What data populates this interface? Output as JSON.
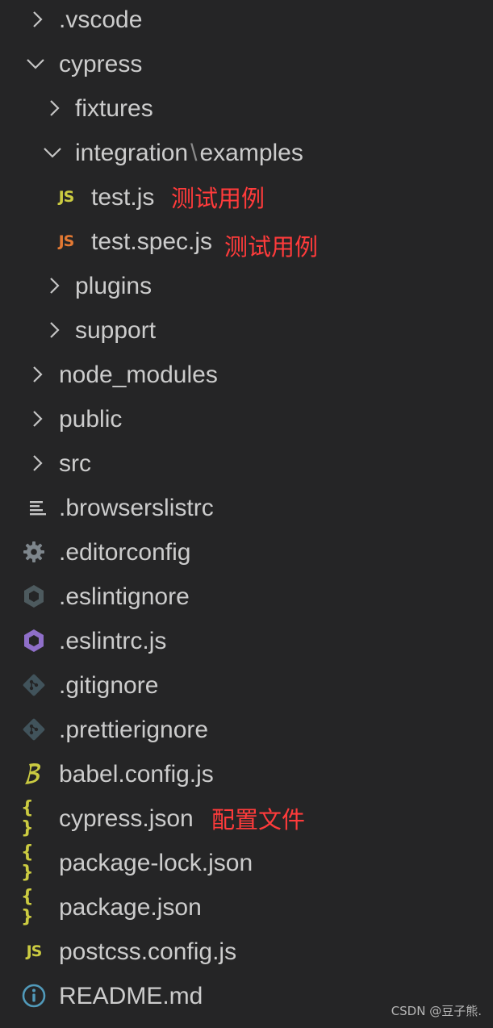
{
  "explorer": {
    "rows": [
      {
        "label": ".vscode",
        "icon": "chevron-right-icon"
      },
      {
        "label": "cypress",
        "icon": "chevron-down-icon"
      },
      {
        "label": "fixtures",
        "icon": "chevron-right-icon"
      },
      {
        "label_part1": "integration",
        "label_sep": "\\",
        "label_part2": "examples",
        "icon": "chevron-down-icon"
      },
      {
        "label": "test.js",
        "icon": "js-icon",
        "note": "测试用例"
      },
      {
        "label": "test.spec.js",
        "icon": "js-test-icon",
        "note": "测试用例"
      },
      {
        "label": "plugins",
        "icon": "chevron-right-icon"
      },
      {
        "label": "support",
        "icon": "chevron-right-icon"
      },
      {
        "label": "node_modules",
        "icon": "chevron-right-icon"
      },
      {
        "label": "public",
        "icon": "chevron-right-icon"
      },
      {
        "label": "src",
        "icon": "chevron-right-icon"
      },
      {
        "label": ".browserslistrc",
        "icon": "list-icon"
      },
      {
        "label": ".editorconfig",
        "icon": "gear-icon"
      },
      {
        "label": ".eslintignore",
        "icon": "eslint-icon"
      },
      {
        "label": ".eslintrc.js",
        "icon": "eslint-icon"
      },
      {
        "label": ".gitignore",
        "icon": "git-icon"
      },
      {
        "label": ".prettierignore",
        "icon": "git-icon"
      },
      {
        "label": "babel.config.js",
        "icon": "babel-icon"
      },
      {
        "label": "cypress.json",
        "icon": "json-icon",
        "note": "配置文件"
      },
      {
        "label": "package-lock.json",
        "icon": "json-icon"
      },
      {
        "label": "package.json",
        "icon": "json-icon"
      },
      {
        "label": "postcss.config.js",
        "icon": "js-icon"
      },
      {
        "label": "README.md",
        "icon": "info-icon"
      }
    ],
    "icon_glyphs": {
      "js": "JS",
      "json": "{ }"
    }
  },
  "colors": {
    "background": "#252526",
    "text": "#cccccc",
    "annotation": "#ff3b3b",
    "js_yellow": "#cbcb41",
    "js_test_orange": "#e37933",
    "eslint_gray": "#4d5a5e",
    "eslint_purple": "#8f6fc9",
    "json_yellow": "#cbcb41",
    "info_blue": "#519aba"
  },
  "watermark": "CSDN @豆子熊."
}
